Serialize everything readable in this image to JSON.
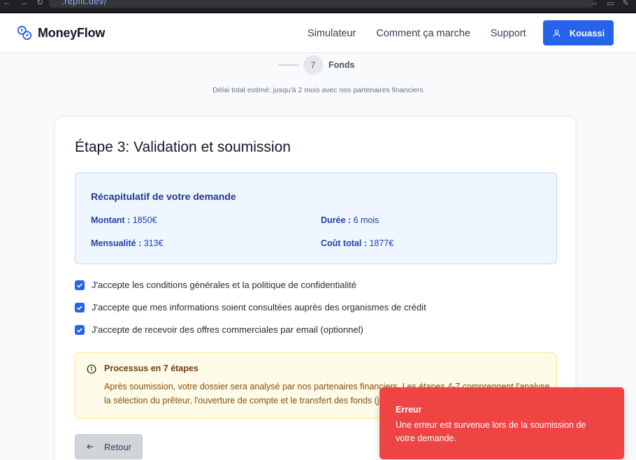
{
  "browser": {
    "url": ".replit.dev/"
  },
  "header": {
    "brand": "MoneyFlow",
    "nav": [
      "Simulateur",
      "Comment ça marche",
      "Support"
    ],
    "user_name": "Kouassi",
    "accent": "#2563eb"
  },
  "stepper": {
    "step_number": "7",
    "step_label": "Fonds",
    "delay_text": "Délai total estimé: jusqu'à 2 mois avec nos partenaires financiers"
  },
  "card": {
    "title": "Étape 3: Validation et soumission",
    "summary": {
      "title": "Récapitulatif de votre demande",
      "amount_label": "Montant :",
      "amount_value": "1850€",
      "duration_label": "Durée :",
      "duration_value": "6 mois",
      "monthly_label": "Mensualité :",
      "monthly_value": "313€",
      "total_label": "Coût total :",
      "total_value": "1877€"
    },
    "checkboxes": [
      {
        "label": "J'accepte les conditions générales et la politique de confidentialité",
        "checked": true
      },
      {
        "label": "J'accepte que mes informations soient consultées auprès des organismes de crédit",
        "checked": true
      },
      {
        "label": "J'accepte de recevoir des offres commerciales par email (optionnel)",
        "checked": true
      }
    ],
    "info": {
      "title": "Processus en 7 étapes",
      "line1": "Après soumission, votre dossier sera analysé par nos partenaires financiers. Les étapes 4-7 comprennent l'analyse,",
      "line2": "la sélection du prêteur, l'ouverture de compte et le transfert des fonds (jusqu'à 2 mois)."
    },
    "back_label": "Retour"
  },
  "toast": {
    "title": "Erreur",
    "message": "Une erreur est survenue lors de la soumission de votre demande.",
    "color": "#ef4444"
  }
}
